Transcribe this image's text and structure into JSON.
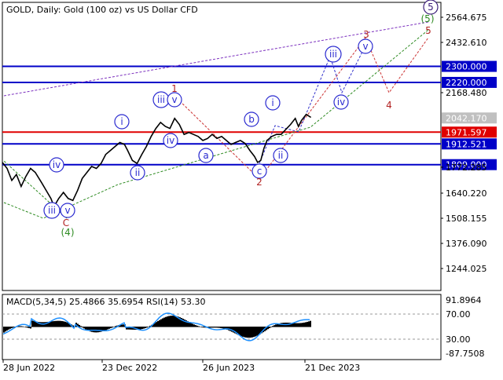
{
  "chart_data": [
    {
      "type": "line",
      "title": "GOLD, Daily:  Gold (100 oz) vs US Dollar CFD",
      "symbol": "GOLD",
      "timeframe": "Daily",
      "x_tick_labels": [
        "28 Jun 2022",
        "23 Dec 2022",
        "26 Jun 2023",
        "21 Dec 2023"
      ],
      "y_tick_labels": [
        "2564.675",
        "2432.610",
        "2300.000",
        "2220.000",
        "2168.480",
        "2042.170",
        "1971.597",
        "1912.521",
        "1809.000",
        "1772.285",
        "1640.220",
        "1508.155",
        "1376.090",
        "1244.025"
      ],
      "ylim": [
        1180,
        2620
      ],
      "series": [
        {
          "values": [
            [
              0,
              1820
            ],
            [
              6,
              1790
            ],
            [
              12,
              1730
            ],
            [
              18,
              1760
            ],
            [
              24,
              1700
            ],
            [
              30,
              1750
            ],
            [
              36,
              1790
            ],
            [
              42,
              1770
            ],
            [
              50,
              1720
            ],
            [
              56,
              1680
            ],
            [
              62,
              1640
            ],
            [
              66,
              1600
            ],
            [
              72,
              1640
            ],
            [
              78,
              1670
            ],
            [
              84,
              1640
            ],
            [
              90,
              1630
            ],
            [
              96,
              1680
            ],
            [
              102,
              1740
            ],
            [
              108,
              1770
            ],
            [
              114,
              1800
            ],
            [
              120,
              1790
            ],
            [
              126,
              1815
            ],
            [
              132,
              1860
            ],
            [
              138,
              1880
            ],
            [
              144,
              1900
            ],
            [
              150,
              1920
            ],
            [
              156,
              1910
            ],
            [
              160,
              1880
            ],
            [
              166,
              1830
            ],
            [
              172,
              1815
            ],
            [
              178,
              1860
            ],
            [
              184,
              1900
            ],
            [
              190,
              1950
            ],
            [
              196,
              1990
            ],
            [
              202,
              2020
            ],
            [
              208,
              2000
            ],
            [
              214,
              1990
            ],
            [
              220,
              2040
            ],
            [
              226,
              2010
            ],
            [
              232,
              1960
            ],
            [
              238,
              1970
            ],
            [
              244,
              1960
            ],
            [
              250,
              1950
            ],
            [
              256,
              1930
            ],
            [
              262,
              1940
            ],
            [
              268,
              1960
            ],
            [
              274,
              1940
            ],
            [
              280,
              1950
            ],
            [
              286,
              1930
            ],
            [
              292,
              1910
            ],
            [
              298,
              1920
            ],
            [
              304,
              1930
            ],
            [
              310,
              1915
            ],
            [
              316,
              1880
            ],
            [
              322,
              1850
            ],
            [
              326,
              1820
            ],
            [
              330,
              1830
            ],
            [
              334,
              1890
            ],
            [
              338,
              1930
            ],
            [
              344,
              1950
            ],
            [
              350,
              1960
            ],
            [
              356,
              1960
            ],
            [
              362,
              1985
            ],
            [
              368,
              2010
            ],
            [
              374,
              2040
            ],
            [
              378,
              2000
            ],
            [
              382,
              2030
            ],
            [
              388,
              2060
            ],
            [
              394,
              2045
            ]
          ],
          "color": "#000000"
        }
      ],
      "horizontal_levels": [
        {
          "value": 2300.0,
          "label": "2300.000",
          "color": "#0000c8"
        },
        {
          "value": 2220.0,
          "label": "2220.000",
          "color": "#0000c8"
        },
        {
          "value": 1971.597,
          "label": "1971.597",
          "color": "#e00000"
        },
        {
          "value": 1912.521,
          "label": "1912.521",
          "color": "#0000c8"
        },
        {
          "value": 1809.0,
          "label": "1809.000",
          "color": "#0000c8"
        }
      ],
      "current_price": {
        "value": 2042.17,
        "label": "2042.170"
      },
      "wave_labels": [
        {
          "text": "iii",
          "style": "circle-blue"
        },
        {
          "text": "v",
          "style": "circle-blue"
        },
        {
          "text": "iv",
          "style": "circle-blue"
        },
        {
          "text": "i",
          "style": "circle-blue"
        },
        {
          "text": "ii",
          "style": "circle-blue"
        },
        {
          "text": "iii",
          "style": "circle-blue"
        },
        {
          "text": "v",
          "style": "circle-blue"
        },
        {
          "text": "iv",
          "style": "circle-blue"
        },
        {
          "text": "a",
          "style": "circle-blue"
        },
        {
          "text": "b",
          "style": "circle-blue"
        },
        {
          "text": "c",
          "style": "circle-blue"
        },
        {
          "text": "i",
          "style": "circle-blue"
        },
        {
          "text": "ii",
          "style": "circle-blue"
        },
        {
          "text": "iii",
          "style": "circle-blue"
        },
        {
          "text": "v",
          "style": "circle-blue"
        },
        {
          "text": "iv",
          "style": "circle-blue"
        },
        {
          "text": "1",
          "style": "red"
        },
        {
          "text": "2",
          "style": "red"
        },
        {
          "text": "3",
          "style": "red"
        },
        {
          "text": "4",
          "style": "red"
        },
        {
          "text": "5",
          "style": "red"
        },
        {
          "text": "C",
          "style": "red"
        },
        {
          "text": "(4)",
          "style": "green"
        },
        {
          "text": "(5)",
          "style": "green-circle"
        },
        {
          "text": "5",
          "style": "circle-purple"
        }
      ]
    },
    {
      "type": "line",
      "title": "MACD(5,34,5) 25.4866 35.6954 RSI(14) 53.30",
      "y_tick_labels": [
        "91.8964",
        "70.00",
        "30.00",
        "-87.7508"
      ],
      "levels": [
        70,
        30
      ],
      "series": [
        {
          "name": "MACD",
          "color": "#000000"
        },
        {
          "name": "RSI",
          "color": "#1e90ff"
        }
      ]
    }
  ]
}
